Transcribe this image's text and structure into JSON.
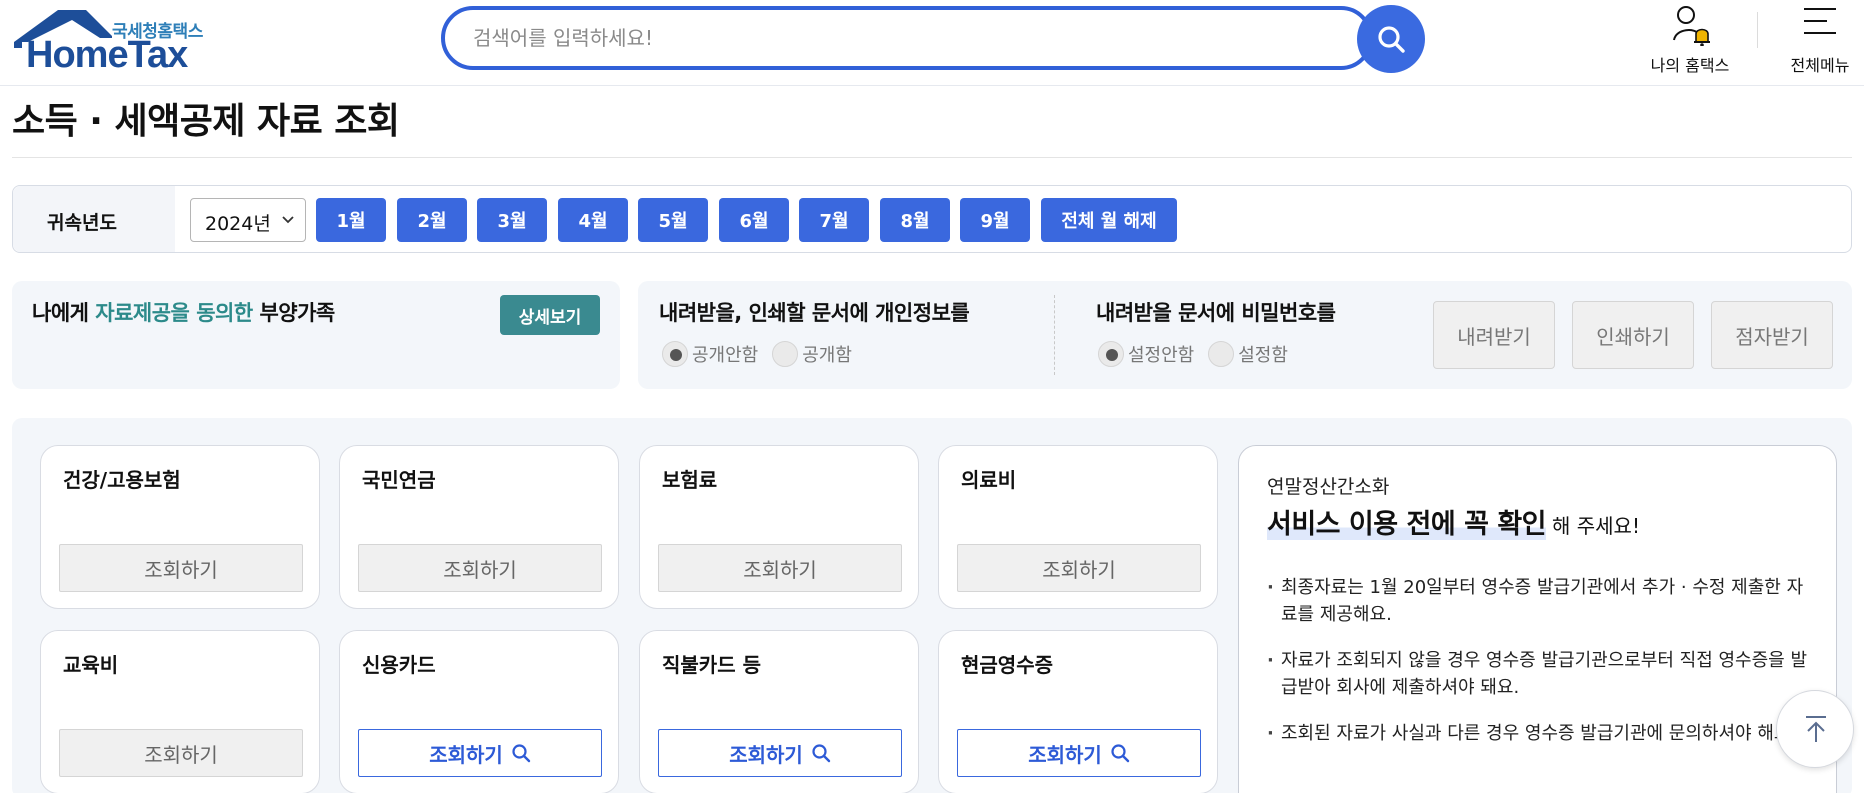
{
  "header": {
    "logo_sub": "국세청홈택스",
    "logo_main": "HomeTax",
    "search_placeholder": "검색어를 입력하세요!",
    "my_hometax": "나의 홈택스",
    "all_menu": "전체메뉴"
  },
  "page": {
    "title": "소득 · 세액공제 자료 조회"
  },
  "year_filter": {
    "label": "귀속년도",
    "selected_year": "2024년",
    "months": [
      "1월",
      "2월",
      "3월",
      "4월",
      "5월",
      "6월",
      "7월",
      "8월",
      "9월"
    ],
    "clear_label": "전체 월 해제"
  },
  "dependents": {
    "prefix": "나에게 ",
    "highlight": "자료제공을 동의한",
    "suffix": " 부양가족",
    "detail_label": "상세보기"
  },
  "document_options": {
    "personal_info": {
      "title": "내려받을, 인쇄할 문서에 개인정보를",
      "options": [
        "공개안함",
        "공개함"
      ],
      "selected": "공개안함"
    },
    "password": {
      "title": "내려받을 문서에 비밀번호를",
      "options": [
        "설정안함",
        "설정함"
      ],
      "selected": "설정안함"
    },
    "buttons": {
      "download": "내려받기",
      "print": "인쇄하기",
      "braille": "점자받기"
    }
  },
  "cards": [
    {
      "name": "건강/고용보험",
      "button": "조회하기",
      "enabled": false
    },
    {
      "name": "국민연금",
      "button": "조회하기",
      "enabled": false
    },
    {
      "name": "보험료",
      "button": "조회하기",
      "enabled": false
    },
    {
      "name": "의료비",
      "button": "조회하기",
      "enabled": false
    },
    {
      "name": "교육비",
      "button": "조회하기",
      "enabled": false
    },
    {
      "name": "신용카드",
      "button": "조회하기",
      "enabled": true
    },
    {
      "name": "직불카드 등",
      "button": "조회하기",
      "enabled": true
    },
    {
      "name": "현금영수증",
      "button": "조회하기",
      "enabled": true
    }
  ],
  "notice": {
    "eyebrow": "연말정산간소화",
    "headline": "서비스 이용 전에 꼭 확인",
    "headline_rest": "해 주세요!",
    "items": [
      "최종자료는 1월 20일부터 영수증 발급기관에서 추가 · 수정 제출한 자료를 제공해요.",
      "자료가 조회되지 않을 경우 영수증 발급기관으로부터 직접 영수증을 발급받아 회사에 제출하셔야 돼요.",
      "조회된 자료가 사실과 다른 경우 영수증 발급기관에 문의하셔야 해요."
    ]
  },
  "colors": {
    "primary": "#3a68de",
    "teal": "#3a8a90",
    "brand": "#1d4e99"
  },
  "icons": {
    "search": "search-icon",
    "my": "user-bell-icon",
    "menu": "hamburger-icon",
    "top": "arrow-up-icon"
  }
}
